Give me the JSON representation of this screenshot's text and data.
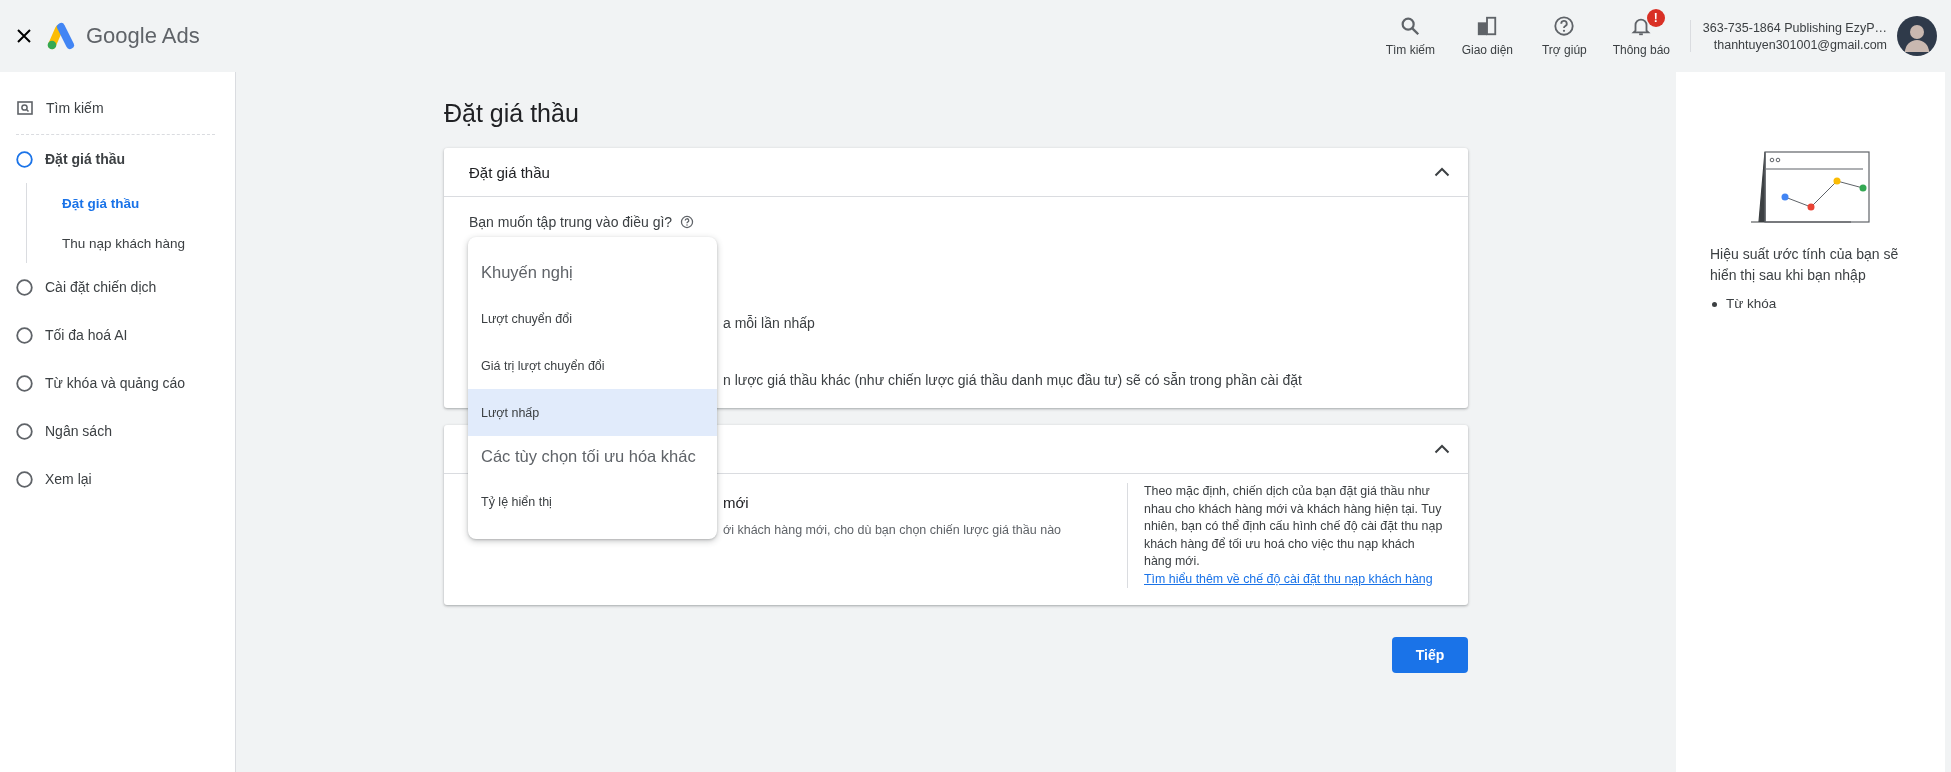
{
  "header": {
    "app_name": "Google Ads",
    "actions": [
      {
        "kind": "search",
        "label": "Tìm kiếm"
      },
      {
        "kind": "layout",
        "label": "Giao diện"
      },
      {
        "kind": "help",
        "label": "Trợ giúp"
      },
      {
        "kind": "bell",
        "label": "Thông báo",
        "badge": "!"
      }
    ],
    "account": {
      "name": "363-735-1864 Publishing EzyP…",
      "email": "thanhtuyen301001@gmail.com"
    }
  },
  "sidebar": {
    "search": "Tìm kiếm",
    "steps": [
      {
        "label": "Đặt giá thầu",
        "selected": true,
        "children": [
          {
            "label": "Đặt giá thầu",
            "selected": true
          },
          {
            "label": "Thu nạp khách hàng",
            "selected": false
          }
        ]
      },
      {
        "label": "Cài đặt chiến dịch",
        "selected": false
      },
      {
        "label": "Tối đa hoá AI",
        "selected": false
      },
      {
        "label": "Từ khóa và quảng cáo",
        "selected": false
      },
      {
        "label": "Ngân sách",
        "selected": false
      },
      {
        "label": "Xem lại",
        "selected": false
      }
    ]
  },
  "page_title": "Đặt giá thầu",
  "bidding_card": {
    "title": "Đặt giá thầu",
    "expanded": true,
    "question": "Bạn muốn tập trung vào điều gì?",
    "line_1": "a mỗi lần nhấp",
    "line_2": "n lược giá thầu khác (như chiến lược giá thầu danh mục đầu tư) sẽ có sẵn trong phần cài đặt"
  },
  "acquisition_card": {
    "expanded": true,
    "heading": "mới",
    "description": "ới khách hàng mới, cho dù bạn chọn chiến lược giá thầu nào",
    "help_text": "Theo mặc định, chiến dịch của bạn đặt giá thầu như nhau cho khách hàng mới và khách hàng hiện tại. Tuy nhiên, bạn có thể định cấu hình chế độ cài đặt thu nạp khách hàng để tối ưu hoá cho việc thu nạp khách hàng mới.",
    "help_link": "Tìm hiểu thêm về chế độ cài đặt thu nạp khách hàng"
  },
  "dropdown": {
    "items": [
      {
        "kind": "header",
        "label": "Khuyến nghị"
      },
      {
        "kind": "option",
        "label": "Lượt chuyển đổi",
        "selected": false
      },
      {
        "kind": "option",
        "label": "Giá trị lượt chuyển đổi",
        "selected": false
      },
      {
        "kind": "option",
        "label": "Lượt nhấp",
        "selected": true
      },
      {
        "kind": "header",
        "label": "Các tùy chọn tối ưu hóa khác"
      },
      {
        "kind": "option",
        "label": "Tỷ lệ hiển thị",
        "selected": false
      }
    ]
  },
  "next_button": "Tiếp",
  "right_panel": {
    "message": "Hiệu suất ước tính của bạn sẽ hiển thị sau khi bạn nhập",
    "bullets": [
      "Từ khóa"
    ]
  }
}
